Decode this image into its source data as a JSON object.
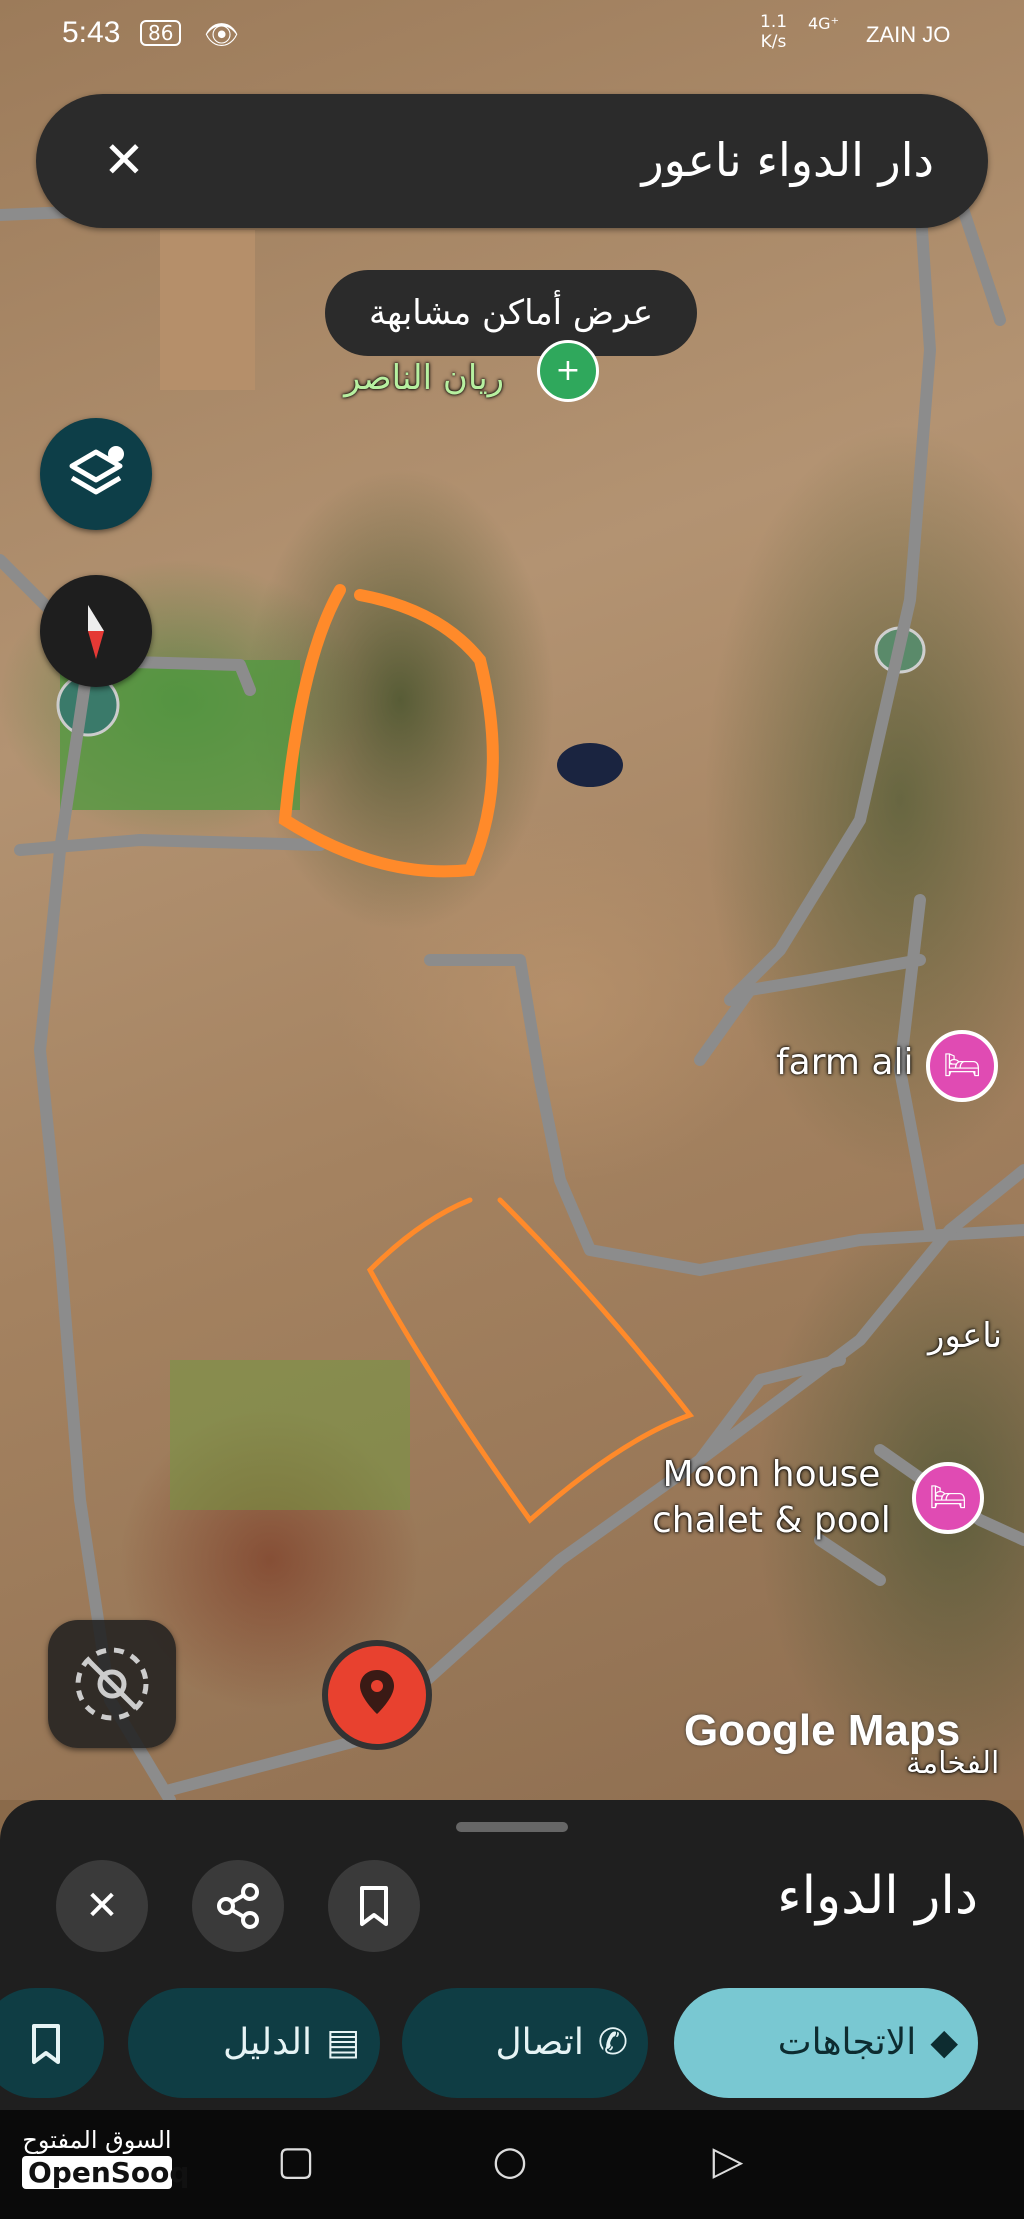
{
  "status_bar": {
    "time": "5:43",
    "battery": "86",
    "speed_value": "1.1",
    "speed_unit": "K/s",
    "network": "4G⁺",
    "carrier": "ZAIN JO"
  },
  "search": {
    "query": "دار الدواء ناعور",
    "close_icon": "close-icon"
  },
  "map": {
    "similar_places_button": "عرض أماكن مشابهة",
    "labels": {
      "rayan": "ريان الناصر",
      "farm_ali": "farm ali",
      "moon_house": "Moon house",
      "moon_house_line2": "chalet & pool",
      "naour": "ناعور",
      "fakhama": "الفخامة"
    },
    "watermark": "Google Maps",
    "highlight_color": "#ff8a2a",
    "road_color": "#8c8c8c"
  },
  "place_sheet": {
    "title": "دار الدواء",
    "actions": {
      "directions": "الاتجاهات",
      "call": "اتصال",
      "guide": "الدليل"
    }
  },
  "app_watermark": {
    "arabic": "السوق المفتوح",
    "english": "OpenSooq"
  }
}
